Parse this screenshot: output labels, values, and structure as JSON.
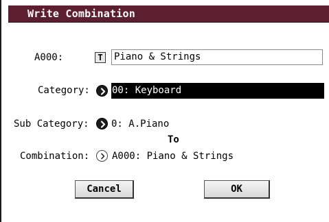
{
  "dialog": {
    "title": "Write Combination"
  },
  "fields": {
    "name_label": "A000:",
    "name_button_glyph": "T",
    "name_value": "Piano & Strings",
    "category_label": "Category:",
    "category_value": "00: Keyboard",
    "subcategory_label": "Sub Category:",
    "subcategory_value": "0: A.Piano",
    "to_label": "To",
    "combination_label": "Combination:",
    "combination_value": "A000: Piano & Strings"
  },
  "buttons": {
    "cancel_label": "Cancel",
    "ok_label": "OK"
  },
  "icons": {
    "text_edit": "text-edit-icon",
    "popup_arrow": "popup-arrow-icon"
  },
  "colors": {
    "titlebar": "#5c1f2f",
    "selected_field_bg": "#000000",
    "selected_field_text": "#ffffff"
  }
}
